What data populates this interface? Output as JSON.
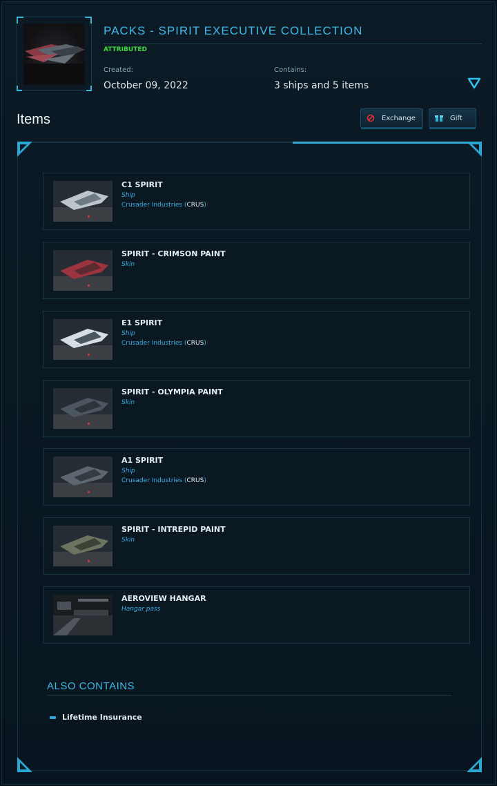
{
  "pack": {
    "title": "PACKS - SPIRIT EXECUTIVE COLLECTION",
    "status": "ATTRIBUTED",
    "created_label": "Created:",
    "created_value": "October 09, 2022",
    "contains_label": "Contains:",
    "contains_value": "3 ships and 5 items"
  },
  "items_section": {
    "heading": "Items",
    "exchange_label": "Exchange",
    "gift_label": "Gift"
  },
  "items": [
    {
      "name": "C1 SPIRIT",
      "type": "Ship",
      "manufacturer": "Crusader Industries",
      "code": "CRUS"
    },
    {
      "name": "SPIRIT - CRIMSON PAINT",
      "type": "Skin"
    },
    {
      "name": "E1 SPIRIT",
      "type": "Ship",
      "manufacturer": "Crusader Industries",
      "code": "CRUS"
    },
    {
      "name": "SPIRIT - OLYMPIA PAINT",
      "type": "Skin"
    },
    {
      "name": "A1 SPIRIT",
      "type": "Ship",
      "manufacturer": "Crusader Industries",
      "code": "CRUS"
    },
    {
      "name": "SPIRIT - INTREPID PAINT",
      "type": "Skin"
    },
    {
      "name": "AEROVIEW HANGAR",
      "type": "Hangar pass"
    }
  ],
  "also_contains": {
    "heading": "ALSO CONTAINS",
    "items": [
      "Lifetime Insurance"
    ]
  },
  "colors": {
    "accent": "#3fb9e6",
    "status_green": "#3bd93b",
    "background": "#07111a"
  },
  "icons": [
    "expand-triangle-icon",
    "exchange-icon",
    "gift-icon"
  ]
}
